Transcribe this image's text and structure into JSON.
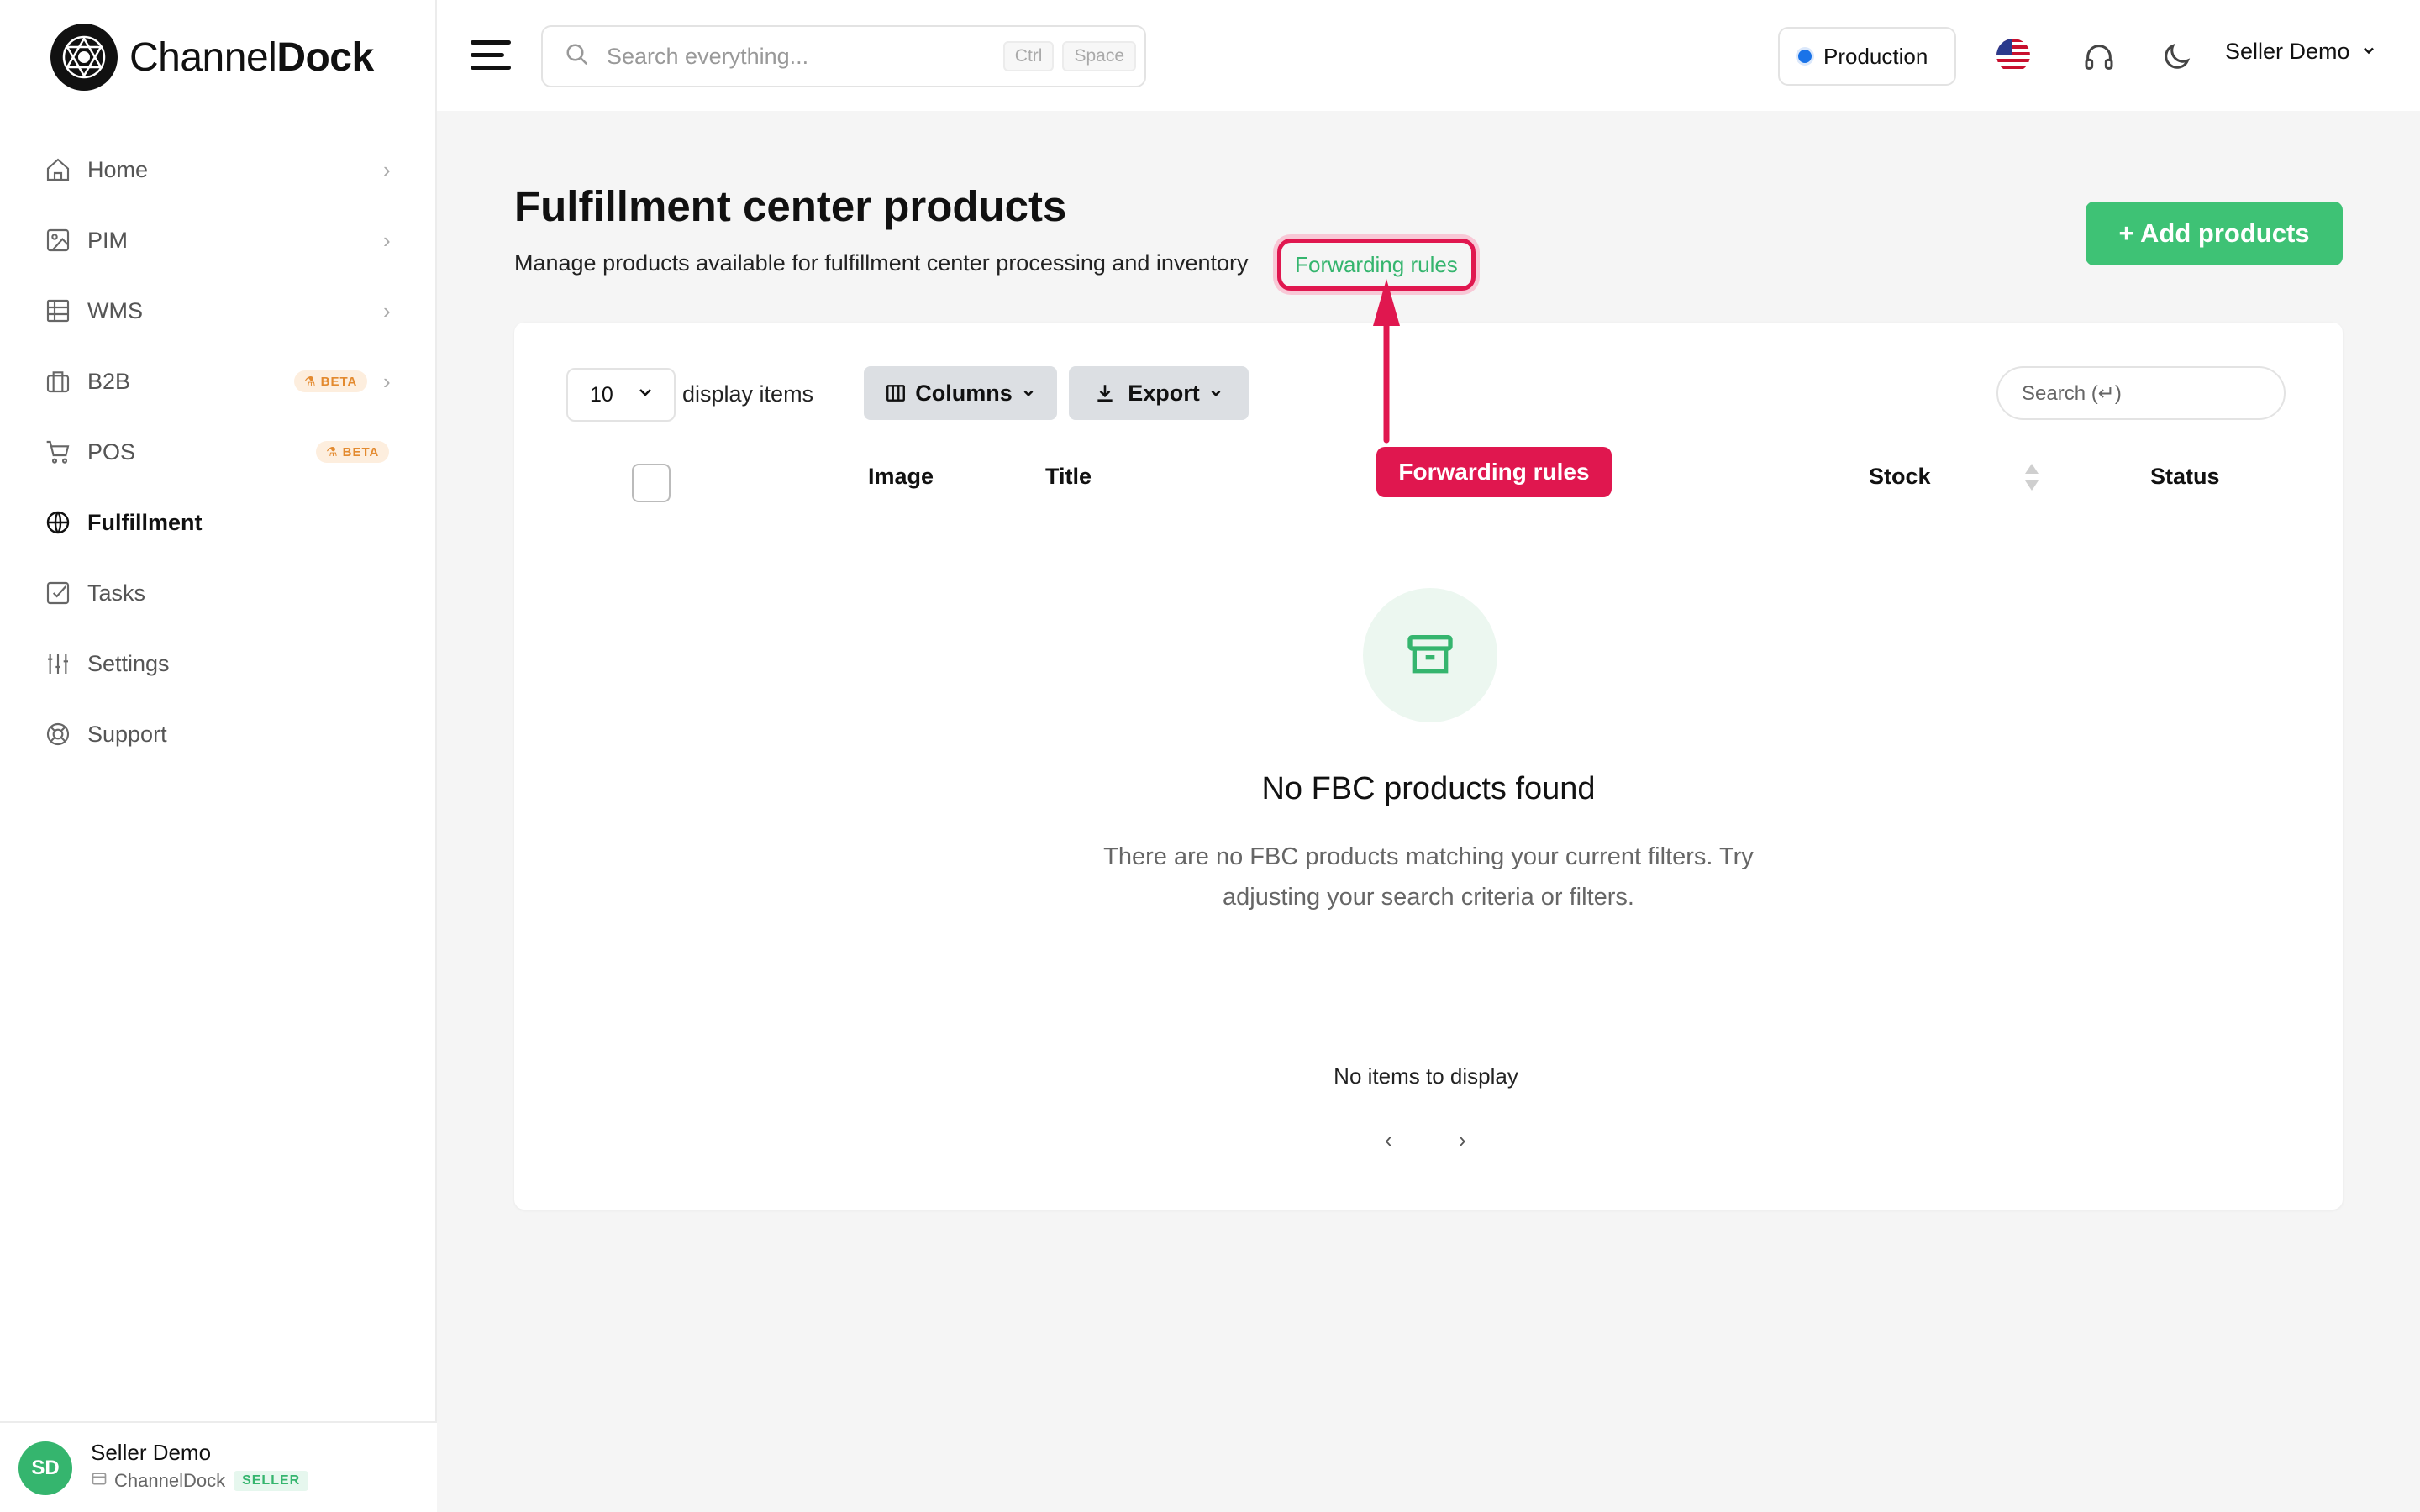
{
  "brand": {
    "name_light": "Channel",
    "name_bold": "Dock"
  },
  "sidebar": {
    "items": [
      {
        "label": "Home",
        "icon": "home-icon",
        "chevron": true
      },
      {
        "label": "PIM",
        "icon": "image-icon",
        "chevron": true
      },
      {
        "label": "WMS",
        "icon": "table-icon",
        "chevron": true
      },
      {
        "label": "B2B",
        "icon": "briefcase-icon",
        "chevron": true,
        "badge": "BETA"
      },
      {
        "label": "POS",
        "icon": "cart-icon",
        "chevron": false,
        "badge": "BETA"
      },
      {
        "label": "Fulfillment",
        "icon": "globe-icon",
        "active": true
      },
      {
        "label": "Tasks",
        "icon": "checkbox-icon"
      },
      {
        "label": "Settings",
        "icon": "sliders-icon"
      },
      {
        "label": "Support",
        "icon": "lifebuoy-icon"
      }
    ],
    "user": {
      "initials": "SD",
      "name": "Seller Demo",
      "org": "ChannelDock",
      "role": "SELLER"
    }
  },
  "header": {
    "search_placeholder": "Search everything...",
    "shortcut_keys": [
      "Ctrl",
      "Space"
    ],
    "environment": "Production",
    "environment_color": "#1a73e8",
    "user_menu": "Seller Demo"
  },
  "main": {
    "title": "Fulfillment center products",
    "subtitle": "Manage products available for fulfillment center processing and inventory",
    "forwarding_link": "Forwarding rules",
    "add_button": "+ Add products",
    "accent_color": "#3ec275"
  },
  "table": {
    "per_page": "10",
    "per_page_label": "display items",
    "columns_button": "Columns",
    "export_button": "Export",
    "search_placeholder": "Search (↵)",
    "headers": [
      "Image",
      "Title",
      "Stock",
      "Status"
    ],
    "empty_title": "No FBC products found",
    "empty_description": "There are no FBC products matching your current filters. Try adjusting your search criteria or filters.",
    "no_items": "No items to display",
    "prev": "‹",
    "next": "›"
  },
  "annotation": {
    "label": "Forwarding rules",
    "color": "#e0174f"
  }
}
